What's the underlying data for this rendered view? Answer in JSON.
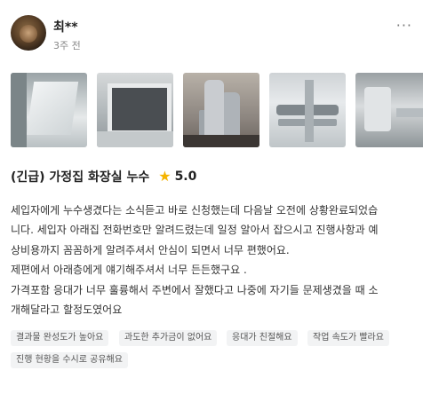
{
  "user": {
    "name": "최**",
    "time": "3주 전"
  },
  "more_icon_glyph": "···",
  "photo_count": 5,
  "review": {
    "title": "(긴급) 가정집 화장실 누수",
    "star_glyph": "★",
    "rating": "5.0",
    "lines": [
      "세입자에게 누수생겼다는 소식듣고 바로 신청했는데 다음날 오전에 상황완료되었습",
      "니다. 세입자 아래집 전화번호만 알려드렸는데 일정 알아서 잡으시고 진행사항과 예",
      "상비용까지 꼼꼼하게 알려주셔서 안심이 되면서 너무 편했어요.",
      "제편에서 아래층에게 얘기해주셔서 너무 든든했구요 .",
      "가격포함 응대가 너무 훌륭해서 주변에서 잘했다고 나중에 자기들 문제생겼을 때 소",
      "개해달라고 할정도였어요"
    ]
  },
  "tags": [
    "결과물 완성도가 높아요",
    "과도한 추가금이 없어요",
    "응대가 친절해요",
    "작업 속도가 빨라요",
    "진행 현황을 수시로 공유해요"
  ],
  "colors": {
    "star": "#f5b400",
    "tag_bg": "#f2f3f4",
    "muted": "#888888"
  }
}
